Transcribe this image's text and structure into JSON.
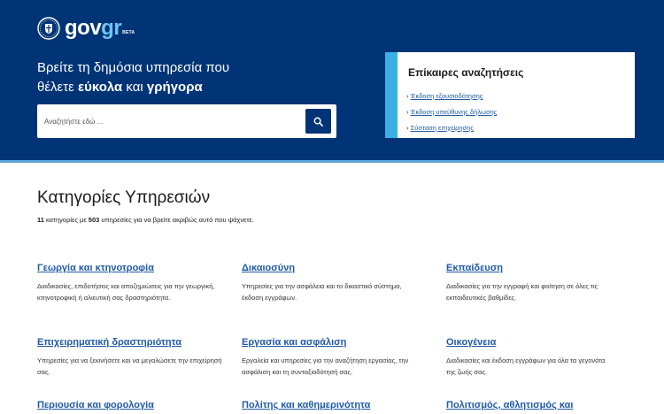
{
  "brand": {
    "gov": "gov",
    "gr": "gr",
    "beta": "BETA"
  },
  "hero": {
    "line1": "Βρείτε τη δημόσια υπηρεσία που",
    "line2_prefix": "θέλετε ",
    "bold1": "εύκολα",
    "middle": " και ",
    "bold2": "γρήγορα"
  },
  "search": {
    "placeholder": "Αναζητήστε εδώ ..."
  },
  "recent": {
    "title": "Επίκαιρες αναζητήσεις",
    "items": [
      {
        "label": "Έκδοση εξουσιοδότησης"
      },
      {
        "label": "Έκδοση υπεύθυνης δήλωσης"
      },
      {
        "label": "Σύσταση επιχείρησης"
      }
    ]
  },
  "categories": {
    "title": "Κατηγορίες Υπηρεσιών",
    "count_categories": "11",
    "text1": " κατηγορίες με ",
    "count_services": "503",
    "text2": " υπηρεσίες για να βρείτε ακριβώς αυτό που ψάχνετε.",
    "items": [
      {
        "title": "Γεωργία και κτηνοτροφία",
        "desc": "Διαδικασίες, επιδοτήσεις και αποζημιώσεις για την γεωργική, κτηνοτροφική ή αλιευτική σας δραστηριότητα."
      },
      {
        "title": "Δικαιοσύνη",
        "desc": "Υπηρεσίες για την ασφάλεια και το δικαστικό σύστημα, έκδοση εγγράφων."
      },
      {
        "title": "Εκπαίδευση",
        "desc": "Διαδικασίες για την εγγραφή και φοίτηση σε όλες τις εκπαιδευτικές βαθμίδες."
      },
      {
        "title": "Επιχειρηματική δραστηριότητα",
        "desc": "Υπηρεσίες για να ξεκινήσετε και να μεγαλώσετε την επιχείρησή σας."
      },
      {
        "title": "Εργασία και ασφάλιση",
        "desc": "Εργαλεία και υπηρεσίες για την αναζήτηση εργασίας, την ασφάλιση και τη συνταξιοδότησή σας."
      },
      {
        "title": "Οικογένεια",
        "desc": "Διαδικασίες και έκδοση εγγράφων για όλα τα γεγονότα της ζωής σας."
      },
      {
        "title": "Περιουσία και φορολογία",
        "desc": ""
      },
      {
        "title": "Πολίτης και καθημερινότητα",
        "desc": ""
      },
      {
        "title": "Πολιτισμός, αθλητισμός και",
        "desc": ""
      }
    ]
  }
}
